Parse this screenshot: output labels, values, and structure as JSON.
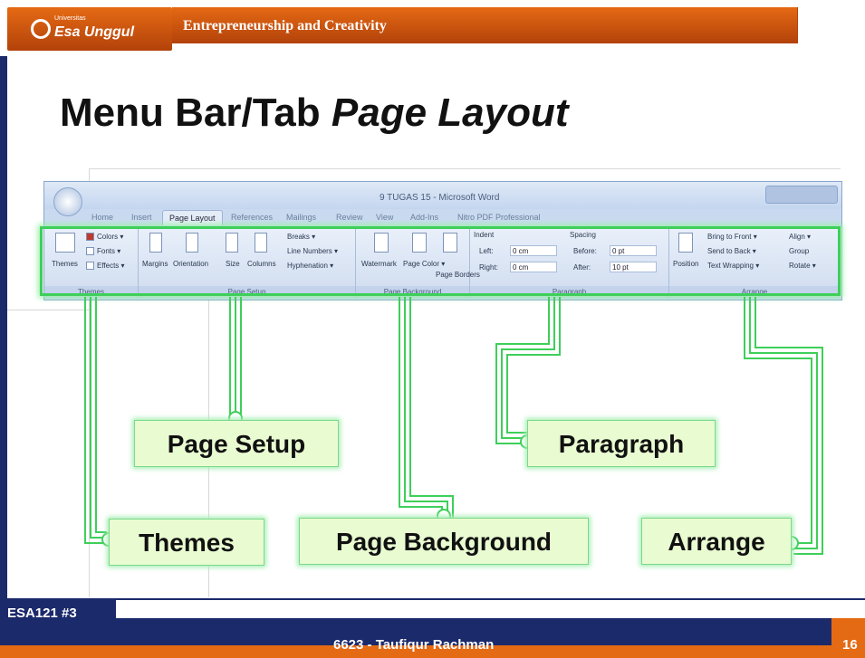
{
  "header": {
    "logo_small": "Universitas",
    "logo_name": "Esa Unggul",
    "course_title": "Entrepreneurship and Creativity"
  },
  "slide": {
    "title_plain": "Menu Bar/Tab ",
    "title_italic": "Page Layout"
  },
  "word": {
    "window_title": "9 TUGAS 15 - Microsoft Word",
    "tabs": [
      "Home",
      "Insert",
      "Page Layout",
      "References",
      "Mailings",
      "Review",
      "View",
      "Add-Ins",
      "Nitro PDF Professional"
    ],
    "active_tab": "Page Layout",
    "groups": {
      "themes": {
        "label": "Themes",
        "themes_btn": "Themes",
        "colors": "Colors ▾",
        "fonts": "Fonts ▾",
        "effects": "Effects ▾"
      },
      "page_setup": {
        "label": "Page Setup",
        "margins": "Margins",
        "orientation": "Orientation",
        "size": "Size",
        "columns": "Columns",
        "breaks": "Breaks ▾",
        "line_numbers": "Line Numbers ▾",
        "hyphenation": "Hyphenation ▾"
      },
      "page_background": {
        "label": "Page Background",
        "watermark": "Watermark",
        "page_color": "Page Color ▾",
        "page_borders": "Page Borders"
      },
      "paragraph": {
        "label": "Paragraph",
        "indent": "Indent",
        "left_label": "Left:",
        "left_value": "0 cm",
        "right_label": "Right:",
        "right_value": "0 cm",
        "spacing": "Spacing",
        "before_label": "Before:",
        "before_value": "0 pt",
        "after_label": "After:",
        "after_value": "10 pt"
      },
      "arrange": {
        "label": "Arrange",
        "position": "Position",
        "bring_to_front": "Bring to Front ▾",
        "send_to_back": "Send to Back ▾",
        "text_wrapping": "Text Wrapping ▾",
        "align": "Align ▾",
        "group": "Group",
        "rotate": "Rotate ▾"
      }
    }
  },
  "callouts": {
    "page_setup": "Page Setup",
    "paragraph": "Paragraph",
    "themes": "Themes",
    "page_background": "Page Background",
    "arrange": "Arrange"
  },
  "footer": {
    "course_code": "ESA121 #3",
    "author": "6623 - Taufiqur Rachman",
    "page_number": "16"
  },
  "colors": {
    "orange": "#e56a14",
    "navy": "#1b2a6b",
    "glow_green": "#3ecf5a",
    "callout_fill": "#e9fbd1"
  }
}
